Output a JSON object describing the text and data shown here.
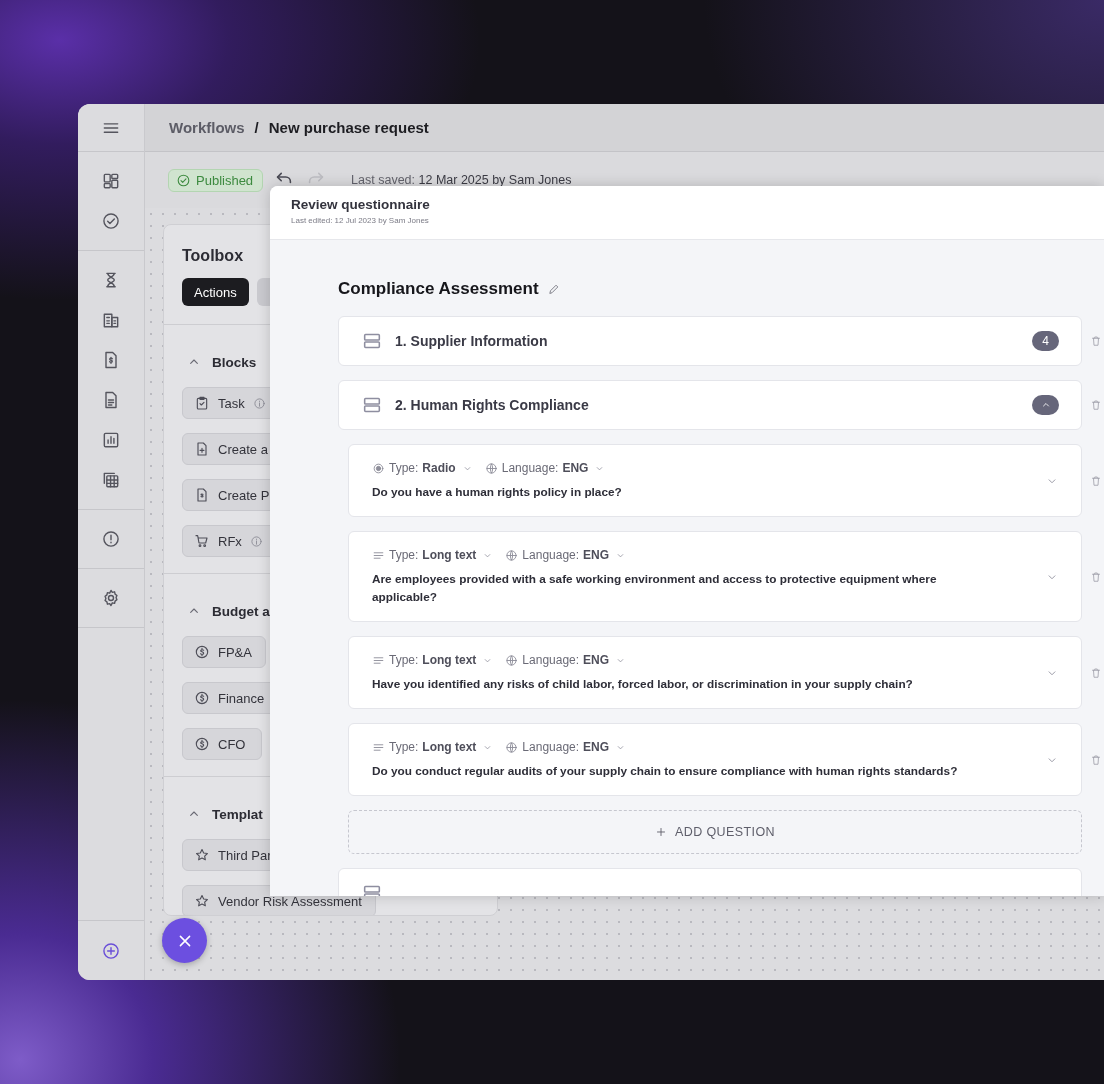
{
  "breadcrumb": {
    "items": [
      "Workflows",
      "New purchase request"
    ],
    "separator": "/"
  },
  "toolbar": {
    "status": "Published",
    "undo": {
      "disabled": false
    },
    "redo": {
      "disabled": true
    },
    "last_saved": "Last saved: **12 Mar 2025 by Sam Jones**"
  },
  "toolbox": {
    "title": "Toolbox",
    "tabs": [
      {
        "label": "Actions",
        "selected": true
      },
      {
        "selected": false
      }
    ],
    "groups": [
      {
        "title": "Blocks",
        "expanded": true,
        "items": [
          {
            "label": "Task",
            "kind": "task",
            "info": true
          },
          {
            "label": "Create a",
            "kind": "agreement",
            "info": false
          },
          {
            "label": "Create P",
            "kind": "po",
            "info": false
          },
          {
            "label": "RFx",
            "kind": "rfx",
            "info": true
          }
        ]
      },
      {
        "title": "Budget a",
        "expanded": true,
        "items": [
          {
            "label": "FP&A",
            "kind": "approver",
            "info": false
          },
          {
            "label": "Finance",
            "kind": "approver",
            "info": false
          },
          {
            "label": "CFO",
            "kind": "approver",
            "info": false
          }
        ]
      },
      {
        "title": "Templat",
        "expanded": true,
        "items": [
          {
            "label": "Third Par",
            "kind": "template",
            "info": false
          },
          {
            "label": "Vendor Risk Assessment",
            "kind": "template",
            "info": false
          }
        ]
      }
    ]
  },
  "modal": {
    "title": "Review questionnaire",
    "subtitle": "Last edited: 12 Jul 2023 by Sam Jones",
    "form_title": "Compliance Assessment",
    "sections": [
      {
        "title": "1. Supplier Information",
        "count": "4",
        "expanded": false
      },
      {
        "title": "2. Human Rights Compliance",
        "expanded": true,
        "questions": [
          {
            "type_label": "Type:",
            "type": "Radio",
            "kind": "radio",
            "language_label": "Language:",
            "language": "ENG",
            "text": "Do you have a human rights policy in place?"
          },
          {
            "type_label": "Type:",
            "type": "Long text",
            "kind": "long_text",
            "language_label": "Language:",
            "language": "ENG",
            "text": "Are employees provided with a safe working environment and access to protective equipment where applicable?"
          },
          {
            "type_label": "Type:",
            "type": "Long text",
            "kind": "long_text",
            "language_label": "Language:",
            "language": "ENG",
            "text": "Have you identified any risks of child labor, forced labor, or discrimination in your supply chain?"
          },
          {
            "type_label": "Type:",
            "type": "Long text",
            "kind": "long_text",
            "language_label": "Language:",
            "language": "ENG",
            "text": "Do you conduct regular audits of your supply chain to ensure compliance with human rights standards?"
          }
        ],
        "add_label": "ADD QUESTION"
      },
      {
        "expanded": false
      }
    ]
  }
}
